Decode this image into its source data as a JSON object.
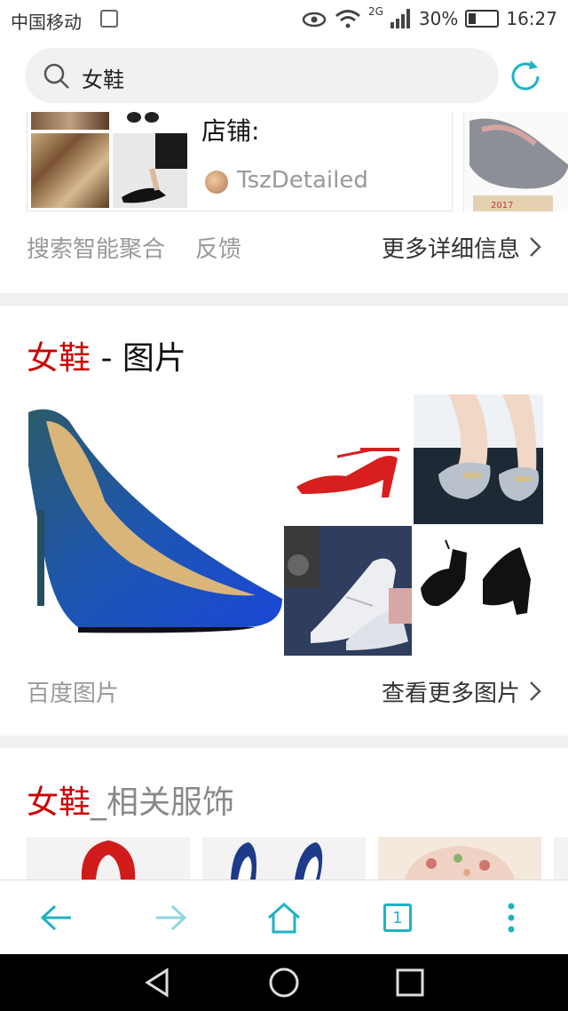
{
  "status_bar": {
    "carrier": "中国移动",
    "network": "2G",
    "battery": "30%",
    "time": "16:27",
    "battery_level": 0.3
  },
  "search": {
    "query": "女鞋"
  },
  "shop_card": {
    "label": "店铺:",
    "user": "TszDetailed"
  },
  "aggregate_links": {
    "left": "搜索智能聚合",
    "feedback": "反馈",
    "more": "更多详细信息"
  },
  "images_section": {
    "keyword": "女鞋",
    "separator": " - ",
    "title": "图片",
    "source": "百度图片",
    "more": "查看更多图片"
  },
  "related_section": {
    "keyword": "女鞋",
    "title": "_相关服饰"
  },
  "toolbar": {
    "tab_count": "1"
  },
  "colors": {
    "accent": "#1fb2c4",
    "keyword": "#cc0000"
  }
}
